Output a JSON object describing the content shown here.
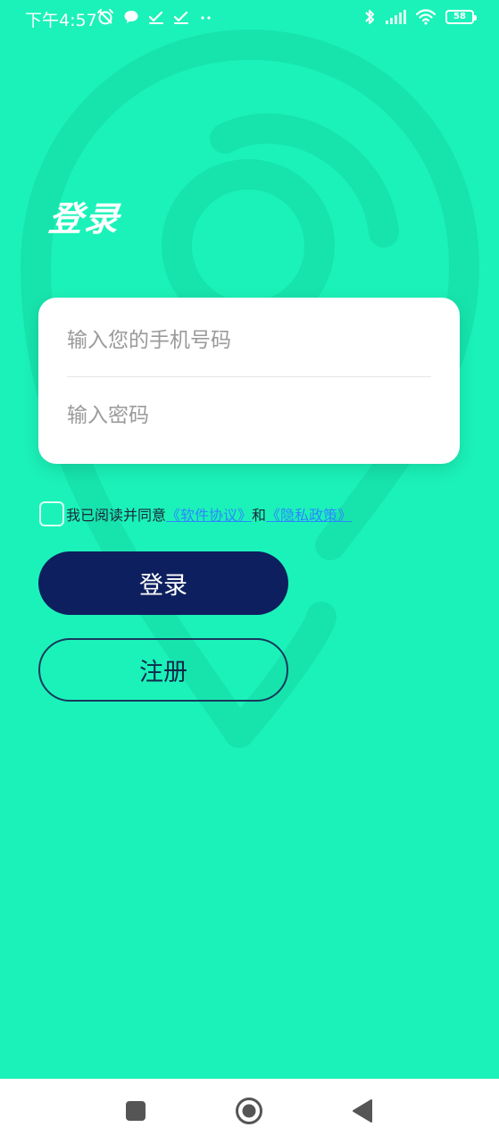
{
  "status_bar": {
    "time": "下午4:57",
    "battery": "58"
  },
  "page": {
    "title": "登录"
  },
  "login_form": {
    "phone_placeholder": "输入您的手机号码",
    "password_placeholder": "输入密码"
  },
  "agreement": {
    "prefix": "我已阅读并同意",
    "software_link": "《软件协议》",
    "conjunction": "和",
    "privacy_link": "《隐私政策》"
  },
  "buttons": {
    "login": "登录",
    "register": "注册"
  },
  "colors": {
    "background": "#1BF2B9",
    "primary_button": "#0D1F5E",
    "link": "#2E86FF"
  }
}
